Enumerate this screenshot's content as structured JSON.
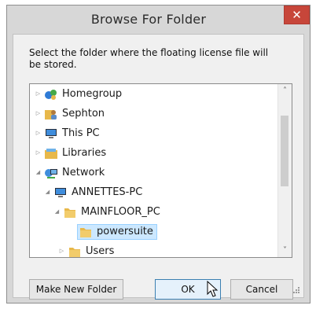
{
  "window": {
    "title": "Browse For Folder",
    "close_glyph": "✕"
  },
  "instructions": "Select the folder where the floating license file will be stored.",
  "tree": {
    "items": [
      {
        "label": "Homegroup",
        "icon": "homegroup-icon",
        "expander": "▷"
      },
      {
        "label": "Sephton",
        "icon": "user-folder-icon",
        "expander": "▷"
      },
      {
        "label": "This PC",
        "icon": "computer-icon",
        "expander": "▷"
      },
      {
        "label": "Libraries",
        "icon": "libraries-icon",
        "expander": "▷"
      },
      {
        "label": "Network",
        "icon": "network-icon",
        "expander": "◢"
      },
      {
        "label": "ANNETTES-PC",
        "icon": "computer-icon",
        "expander": "◢"
      },
      {
        "label": "MAINFLOOR_PC",
        "icon": "folder-icon",
        "expander": "◢"
      },
      {
        "label": "powersuite",
        "icon": "folder-icon",
        "expander": "",
        "selected": true
      },
      {
        "label": "Users",
        "icon": "folder-icon",
        "expander": "▷"
      }
    ]
  },
  "scrollbar": {
    "up_glyph": "˄",
    "down_glyph": "˅"
  },
  "buttons": {
    "make_new_folder": "Make New Folder",
    "ok": "OK",
    "cancel": "Cancel"
  },
  "colors": {
    "selection_bg": "#cce8ff",
    "close_bg": "#c7463a",
    "folder": "#e8b84a"
  }
}
